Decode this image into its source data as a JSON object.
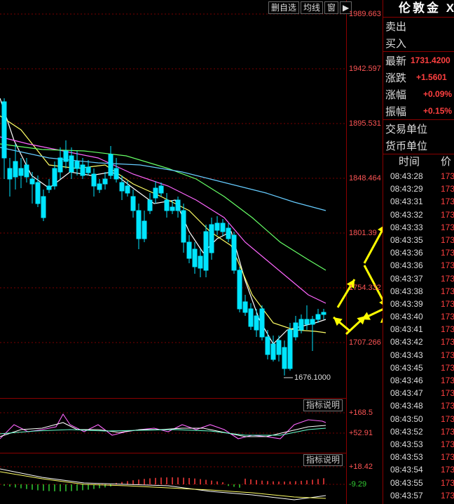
{
  "toolbar": {
    "delete_watch_label": "删自选",
    "ma_label": "均线",
    "window_label": "窗",
    "nav_icon": "next-arrow-icon"
  },
  "price_axis": {
    "labels": [
      "1989.663",
      "1942.597",
      "1895.531",
      "1848.464",
      "1801.39",
      "1754.332",
      "1707.266"
    ]
  },
  "low_marker": "1676.1000",
  "indicator1": {
    "button_label": "指标说明",
    "axis_labels": [
      "+168.5",
      "+52.91"
    ]
  },
  "indicator2": {
    "button_label": "指标说明",
    "axis_labels": [
      "+18.42",
      "-9.29"
    ]
  },
  "quote": {
    "title": "伦敦金 X",
    "sell_label": "卖出",
    "buy_label": "买入",
    "latest_label": "最新",
    "latest_value": "1731.4200",
    "change_label": "涨跌",
    "change_value": "+1.5601",
    "change_pct_label": "涨幅",
    "change_pct_value": "+0.09%",
    "amplitude_label": "振幅",
    "amplitude_value": "+0.15%",
    "unit_label": "交易单位",
    "currency_label": "货币单位",
    "col_time": "时间",
    "col_price": "价",
    "ticks": [
      {
        "time": "08:43:28",
        "price": "173"
      },
      {
        "time": "08:43:29",
        "price": "173"
      },
      {
        "time": "08:43:31",
        "price": "173"
      },
      {
        "time": "08:43:32",
        "price": "173"
      },
      {
        "time": "08:43:33",
        "price": "173"
      },
      {
        "time": "08:43:35",
        "price": "173"
      },
      {
        "time": "08:43:36",
        "price": "173"
      },
      {
        "time": "08:43:36",
        "price": "173"
      },
      {
        "time": "08:43:37",
        "price": "173"
      },
      {
        "time": "08:43:38",
        "price": "173"
      },
      {
        "time": "08:43:39",
        "price": "173"
      },
      {
        "time": "08:43:40",
        "price": "173"
      },
      {
        "time": "08:43:41",
        "price": "173"
      },
      {
        "time": "08:43:42",
        "price": "173"
      },
      {
        "time": "08:43:43",
        "price": "173"
      },
      {
        "time": "08:43:45",
        "price": "173"
      },
      {
        "time": "08:43:46",
        "price": "173"
      },
      {
        "time": "08:43:47",
        "price": "173"
      },
      {
        "time": "08:43:48",
        "price": "173"
      },
      {
        "time": "08:43:50",
        "price": "173"
      },
      {
        "time": "08:43:52",
        "price": "173"
      },
      {
        "time": "08:43:53",
        "price": "173"
      },
      {
        "time": "08:43:53",
        "price": "173"
      },
      {
        "time": "08:43:54",
        "price": "173"
      },
      {
        "time": "08:43:55",
        "price": "173"
      },
      {
        "time": "08:43:57",
        "price": "173"
      }
    ]
  },
  "colors": {
    "up": "#ff3b3b",
    "down": "#00e5ff",
    "grid": "#7a0000",
    "arrow": "#ffff00"
  }
}
